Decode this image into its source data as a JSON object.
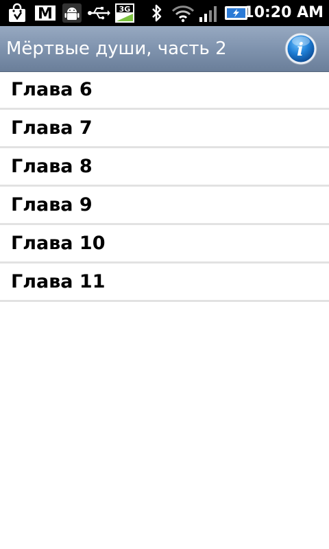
{
  "status_bar": {
    "time": "10:20 AM",
    "icons": [
      "shopping-bag-icon",
      "gmail-icon",
      "android-icon",
      "usb-icon",
      "3g-icon",
      "bluetooth-icon",
      "wifi-icon",
      "signal-icon",
      "battery-charging-icon"
    ],
    "network_label": "3G",
    "gmail_label": "M"
  },
  "header": {
    "title": "Мёртвые души, часть 2",
    "info_icon": "info-icon",
    "info_label": "i"
  },
  "chapters": [
    {
      "label": "Глава 6"
    },
    {
      "label": "Глава 7"
    },
    {
      "label": "Глава 8"
    },
    {
      "label": "Глава 9"
    },
    {
      "label": "Глава 10"
    },
    {
      "label": "Глава 11"
    }
  ],
  "colors": {
    "title_bar": "#7f93ae",
    "divider": "#e2e2e2",
    "info_blue": "#1f7fd6"
  }
}
